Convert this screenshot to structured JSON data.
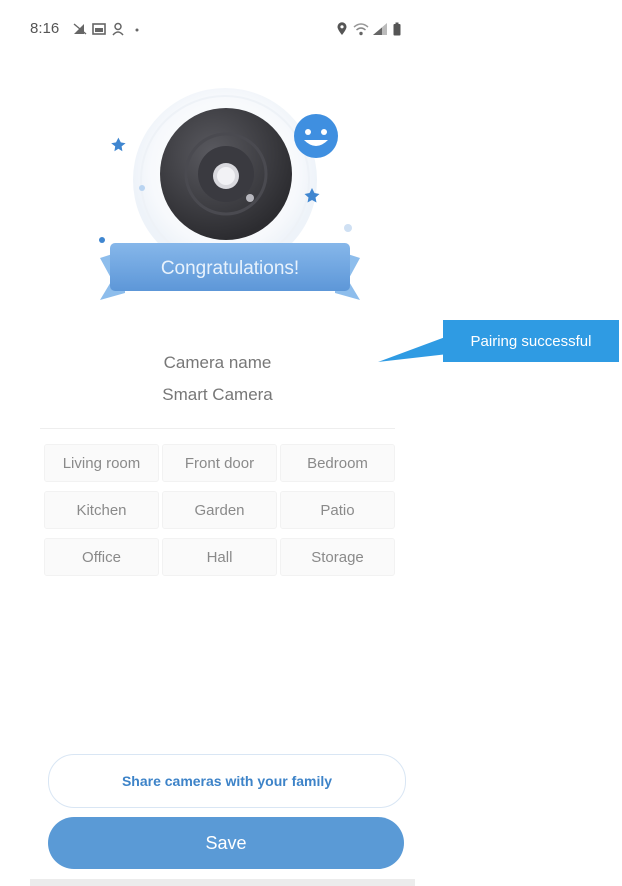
{
  "status_bar": {
    "time": "8:16"
  },
  "hero": {
    "banner_text": "Congratulations!"
  },
  "camera_name": {
    "label": "Camera name",
    "value": "Smart Camera"
  },
  "rooms": [
    "Living room",
    "Front door",
    "Bedroom",
    "Kitchen",
    "Garden",
    "Patio",
    "Office",
    "Hall",
    "Storage"
  ],
  "buttons": {
    "share_label": "Share cameras with your family",
    "save_label": "Save"
  },
  "callout": {
    "text": "Pairing successful"
  },
  "colors": {
    "accent": "#5a9ad6",
    "callout": "#2f9be3",
    "share_text": "#3d83c8"
  }
}
